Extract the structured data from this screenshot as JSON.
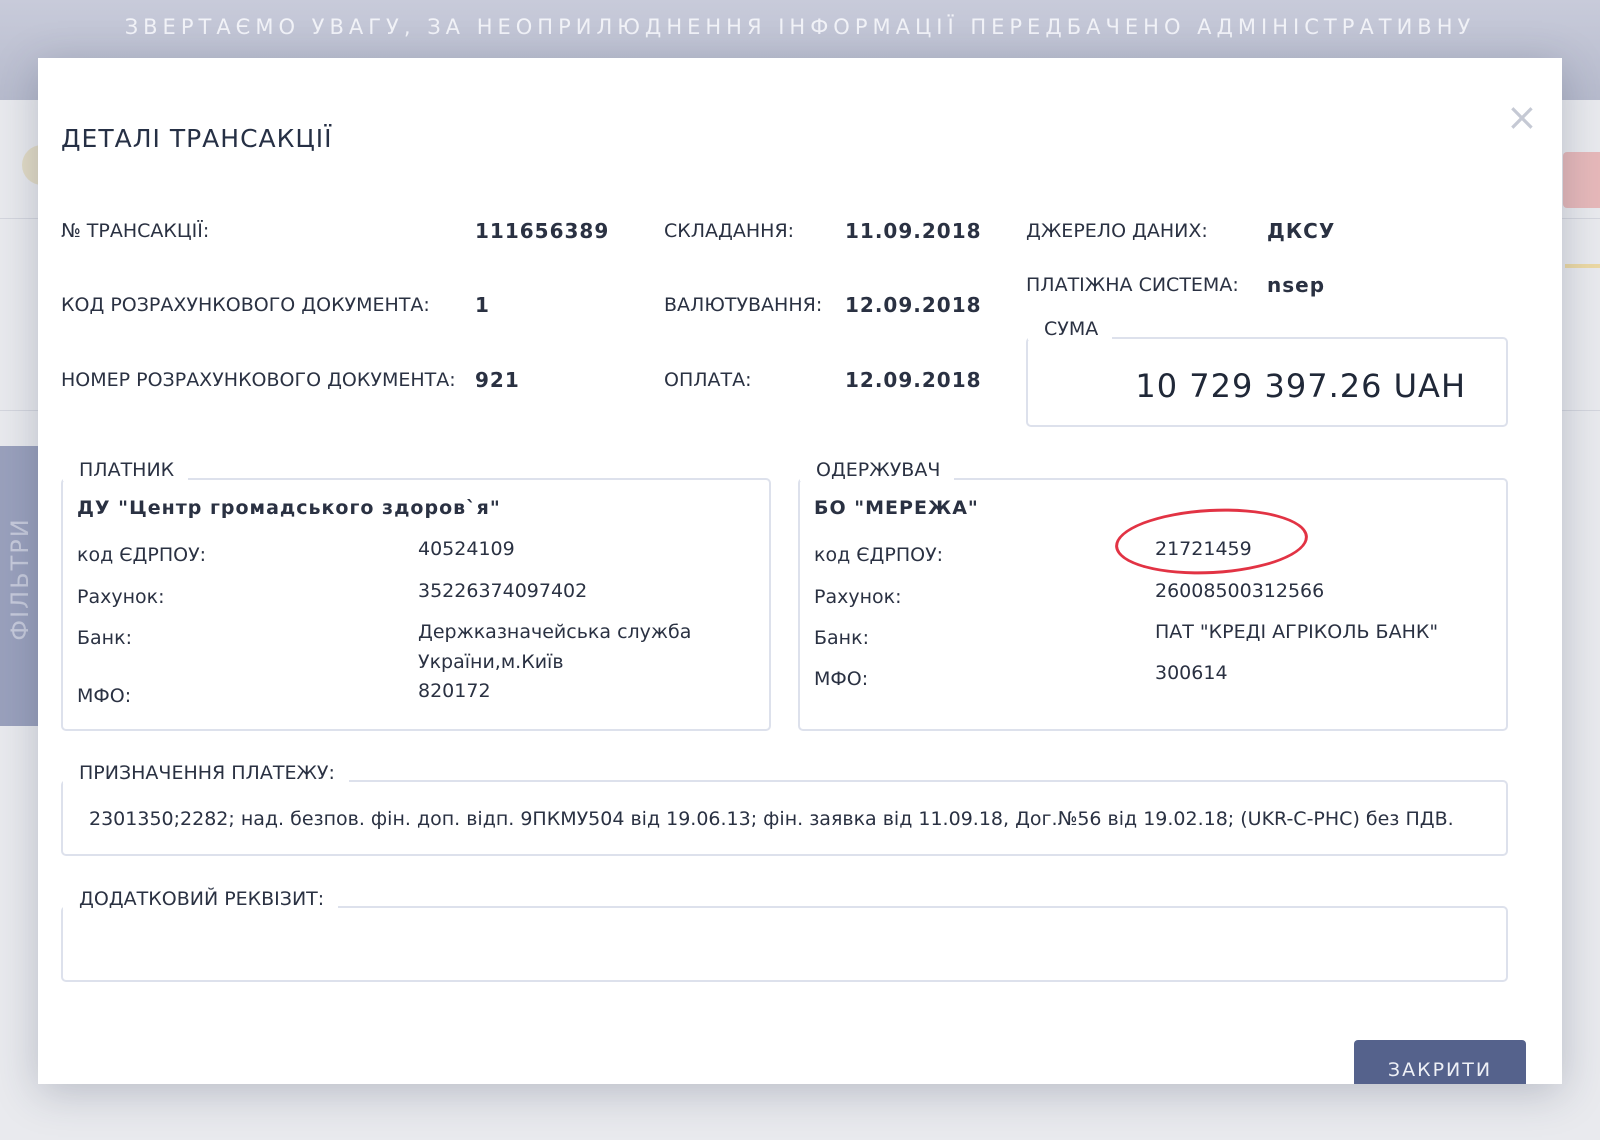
{
  "background": {
    "banner_text": "ЗВЕРТАЄМО УВАГУ, ЗА НЕОПРИЛЮДНЕННЯ ІНФОРМАЦІЇ ПЕРЕДБАЧЕНО АДМІНІСТРАТИВНУ",
    "filter_label": "ФІЛЬТРИ"
  },
  "modal": {
    "title": "ДЕТАЛІ ТРАНСАКЦІЇ",
    "close_symbol": "×",
    "fields": {
      "transaction_no": {
        "label": "№ ТРАНСАКЦІЇ:",
        "value": "111656389"
      },
      "doc_code": {
        "label": "КОД РОЗРАХУНКОВОГО ДОКУМЕНТА:",
        "value": "1"
      },
      "doc_number": {
        "label": "НОМЕР РОЗРАХУНКОВОГО ДОКУМЕНТА:",
        "value": "921"
      },
      "drafted": {
        "label": "СКЛАДАННЯ:",
        "value": "11.09.2018"
      },
      "value_date": {
        "label": "ВАЛЮТУВАННЯ:",
        "value": "12.09.2018"
      },
      "payment": {
        "label": "ОПЛАТА:",
        "value": "12.09.2018"
      },
      "data_source": {
        "label": "ДЖЕРЕЛО ДАНИХ:",
        "value": "ДКСУ"
      },
      "payment_system": {
        "label": "ПЛАТІЖНА СИСТЕМА:",
        "value": "nsep"
      }
    },
    "sum": {
      "legend": "СУМА",
      "value": "10 729 397.26 UAH"
    },
    "payer": {
      "legend": "ПЛАТНИК",
      "name": "ДУ \"Центр громадського здоров`я\"",
      "edrpou_label": "код ЄДРПОУ:",
      "edrpou": "40524109",
      "account_label": "Рахунок:",
      "account": "35226374097402",
      "bank_label": "Банк:",
      "bank": "Держказначейська служба України,м.Київ",
      "mfo_label": "МФО:",
      "mfo": "820172"
    },
    "recipient": {
      "legend": "ОДЕРЖУВАЧ",
      "name": "БО \"МЕРЕЖА\"",
      "edrpou_label": "код ЄДРПОУ:",
      "edrpou": "21721459",
      "account_label": "Рахунок:",
      "account": "26008500312566",
      "bank_label": "Банк:",
      "bank": "ПАТ \"КРЕДІ АГРІКОЛЬ БАНК\"",
      "mfo_label": "МФО:",
      "mfo": "300614"
    },
    "purpose": {
      "legend": "ПРИЗНАЧЕННЯ ПЛАТЕЖУ:",
      "text": "2301350;2282; над. безпов. фін. доп. відп. 9ПКМУ504 від 19.06.13; фін. заявка від 11.09.18, Дог.№56 від 19.02.18; (UKR-C-PHC) без ПДВ."
    },
    "extra": {
      "legend": "ДОДАТКОВИЙ РЕКВІЗИТ:",
      "text": ""
    },
    "button_label": "ЗАКРИТИ"
  },
  "colors": {
    "annotation": "#e23344",
    "button": "#55628c"
  }
}
